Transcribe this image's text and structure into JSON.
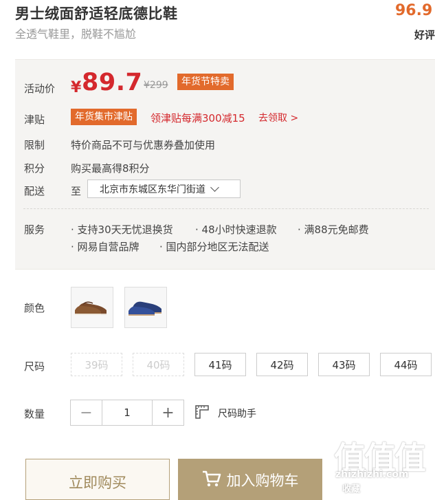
{
  "header": {
    "title": "男士绒面舒适轻底德比鞋",
    "subtitle": "全透气鞋里，脱鞋不尴尬",
    "rating_value": "96.9",
    "rating_label": "好评"
  },
  "price": {
    "label": "活动价",
    "symbol": "¥",
    "value": "89.7",
    "original": "¥299",
    "promo_tag": "年货节特卖"
  },
  "subsidy": {
    "label": "津贴",
    "tag": "年货集市津贴",
    "text": "领津贴每满300减15",
    "link": "去领取 >"
  },
  "restriction": {
    "label": "限制",
    "text": "特价商品不可与优惠券叠加使用"
  },
  "points": {
    "label": "积分",
    "text": "购买最高得8积分"
  },
  "delivery": {
    "label": "配送",
    "prefix": "至",
    "address": "北京市东城区东华门街道"
  },
  "services": {
    "label": "服务",
    "items": [
      "支持30天无忧退换货",
      "48小时快速退款",
      "满88元免邮费",
      "网易自营品牌",
      "国内部分地区无法配送"
    ]
  },
  "color": {
    "label": "颜色",
    "options": [
      "brown",
      "navy"
    ]
  },
  "size": {
    "label": "尺码",
    "options": [
      {
        "label": "39码",
        "available": false
      },
      {
        "label": "40码",
        "available": false
      },
      {
        "label": "41码",
        "available": true
      },
      {
        "label": "42码",
        "available": true
      },
      {
        "label": "43码",
        "available": true
      },
      {
        "label": "44码",
        "available": true
      }
    ]
  },
  "quantity": {
    "label": "数量",
    "minus": "−",
    "value": "1",
    "plus": "+",
    "helper": "尺码助手"
  },
  "actions": {
    "buy_now": "立即购买",
    "add_cart": "加入购物车"
  },
  "watermark": {
    "main": "值值值",
    "sub": "zhizhizhi.com",
    "sub2": "收藏"
  },
  "colors": {
    "accent": "#d4282d",
    "orange": "#e26a2c",
    "gold": "#b4a078",
    "panel": "#f5f4f2"
  }
}
